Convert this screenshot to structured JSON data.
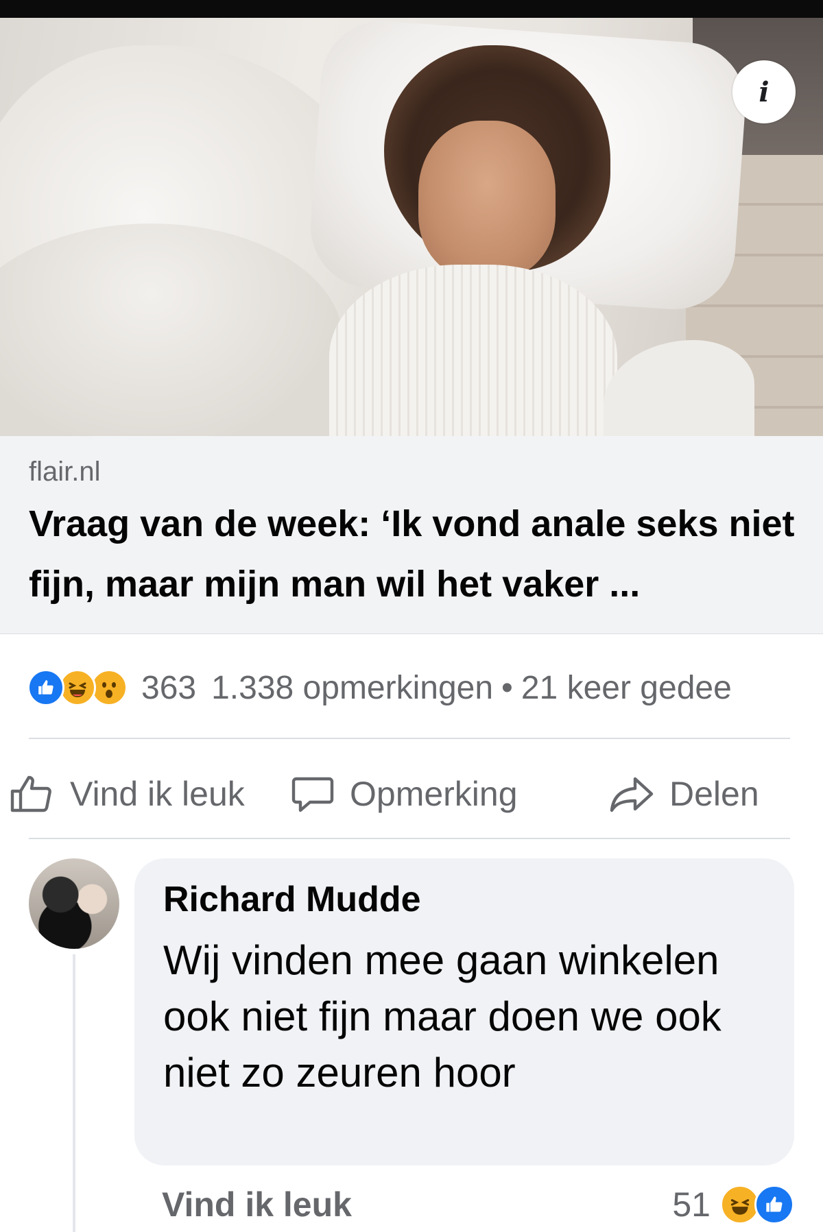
{
  "link_preview": {
    "domain": "flair.nl",
    "headline": "Vraag van de week: ‘Ik vond anale seks niet fijn, maar mijn man wil het vaker ..."
  },
  "post_stats": {
    "reaction_icons": [
      "like-icon",
      "haha-icon",
      "wow-icon"
    ],
    "reaction_count": "363",
    "comments": "1.338 opmerkingen",
    "separator": "•",
    "shares": "21 keer gedee"
  },
  "actions": {
    "like": "Vind ik leuk",
    "comment": "Opmerking",
    "share": "Delen"
  },
  "comment": {
    "author": "Richard Mudde",
    "text": "Wij vinden mee gaan winkelen ook niet fijn maar doen we ook niet zo zeuren hoor",
    "like_label": "Vind ik leuk",
    "reaction_count": "51",
    "reaction_icons": [
      "haha-icon",
      "like-icon"
    ]
  },
  "colors": {
    "like_blue": "#1877f2",
    "emoji_yellow": "#f7b125",
    "secondary_text": "#65676b",
    "card_bg": "#f2f3f5",
    "bubble_bg": "#f0f2f5"
  }
}
